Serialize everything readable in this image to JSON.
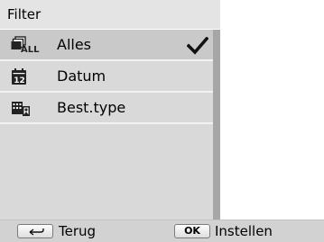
{
  "header": {
    "title": "Filter"
  },
  "menu": {
    "items": [
      {
        "label": "Alles",
        "icon": "all-filter-icon",
        "selected": true
      },
      {
        "label": "Datum",
        "icon": "calendar-date-icon",
        "selected": false
      },
      {
        "label": "Best.type",
        "icon": "file-type-icon",
        "selected": false
      }
    ]
  },
  "footer": {
    "back_key": "return-arrow-icon",
    "back_label": "Terug",
    "ok_key": "OK",
    "ok_label": "Instellen"
  },
  "colors": {
    "panel_bg": "#d9d9d9",
    "selected_bg": "#c9c9c9",
    "scrollbar": "#a6a6a6",
    "footer_bg": "#d2d2d2"
  }
}
